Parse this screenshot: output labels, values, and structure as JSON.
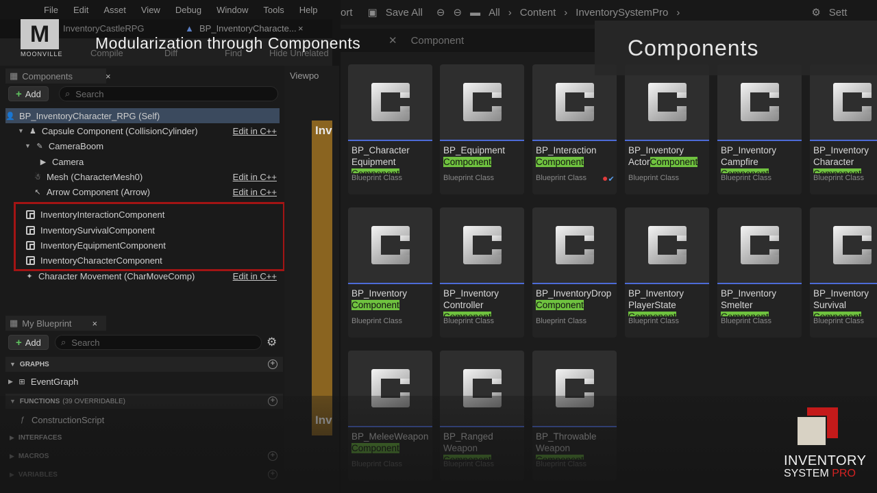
{
  "menu": [
    "File",
    "Edit",
    "Asset",
    "View",
    "Debug",
    "Window",
    "Tools",
    "Help"
  ],
  "doc_tabs": [
    "InventoryCastleRPG",
    "BP_InventoryCharacte..."
  ],
  "toolbar_ghost": [
    "Compile",
    "Diff",
    "Find",
    "Hide Unrelated"
  ],
  "components_panel": {
    "title": "Components",
    "add_label": "Add",
    "search_placeholder": "Search",
    "tree": [
      {
        "label": "BP_InventoryCharacter_RPG (Self)",
        "edit": ""
      },
      {
        "label": "Capsule Component (CollisionCylinder)",
        "edit": "Edit in C++"
      },
      {
        "label": "CameraBoom",
        "edit": ""
      },
      {
        "label": "Camera",
        "edit": ""
      },
      {
        "label": "Mesh (CharacterMesh0)",
        "edit": "Edit in C++"
      },
      {
        "label": "Arrow Component (Arrow)",
        "edit": "Edit in C++"
      },
      {
        "label": "InventoryInteractionComponent",
        "edit": ""
      },
      {
        "label": "InventorySurvivalComponent",
        "edit": ""
      },
      {
        "label": "InventoryEquipmentComponent",
        "edit": ""
      },
      {
        "label": "InventoryCharacterComponent",
        "edit": ""
      },
      {
        "label": "Character Movement (CharMoveComp)",
        "edit": "Edit in C++"
      }
    ]
  },
  "my_blueprint": {
    "title": "My Blueprint",
    "add_label": "Add",
    "search_placeholder": "Search",
    "graphs_label": "GRAPHS",
    "event_graph": "EventGraph",
    "functions_label": "FUNCTIONS",
    "functions_count": "(39 OVERRIDABLE)",
    "construction_script": "ConstructionScript",
    "interfaces_label": "INTERFACES",
    "macros_label": "MACROS",
    "variables_label": "VARIABLES"
  },
  "viewport": {
    "tab": "Viewpo",
    "node_label_1": "Inv",
    "node_label_2": "Inv"
  },
  "content_browser": {
    "save_all": "Save All",
    "path": [
      "All",
      "Content",
      "InventorySystemPro"
    ],
    "settings": "Sett",
    "filter_text": "Component",
    "assets": [
      {
        "pre": "BP_Character Equipment ",
        "hl": "Component",
        "post": "",
        "cls": "Blueprint Class",
        "badge": false
      },
      {
        "pre": "BP_Equipment ",
        "hl": "Component",
        "post": "",
        "cls": "Blueprint Class",
        "badge": false
      },
      {
        "pre": "BP_Interaction ",
        "hl": "Component",
        "post": "",
        "cls": "Blueprint Class",
        "badge": true
      },
      {
        "pre": "BP_Inventory Actor",
        "hl": "Component",
        "post": "",
        "cls": "Blueprint Class",
        "badge": false
      },
      {
        "pre": "BP_Inventory Campfire ",
        "hl": "Component",
        "post": "",
        "cls": "Blueprint Class",
        "badge": false
      },
      {
        "pre": "BP_Inventory Character ",
        "hl": "Component",
        "post": "",
        "cls": "Blueprint Class",
        "badge": false
      },
      {
        "pre": "BP_Inventory ",
        "hl": "Component",
        "post": "",
        "cls": "Blueprint Class",
        "badge": false
      },
      {
        "pre": "BP_Inventory Controller ",
        "hl": "Component",
        "post": "",
        "cls": "Blueprint Class",
        "badge": false
      },
      {
        "pre": "BP_InventoryDrop ",
        "hl": "Component",
        "post": "",
        "cls": "Blueprint Class",
        "badge": false
      },
      {
        "pre": "BP_Inventory PlayerState ",
        "hl": "Component",
        "post": "",
        "cls": "Blueprint Class",
        "badge": false
      },
      {
        "pre": "BP_Inventory Smelter ",
        "hl": "Component",
        "post": "",
        "cls": "Blueprint Class",
        "badge": false
      },
      {
        "pre": "BP_Inventory Survival ",
        "hl": "Component",
        "post": "",
        "cls": "Blueprint Class",
        "badge": false
      },
      {
        "pre": "BP_MeleeWeapon ",
        "hl": "Component",
        "post": "",
        "cls": "Blueprint Class",
        "badge": false
      },
      {
        "pre": "BP_Ranged Weapon ",
        "hl": "Component",
        "post": "",
        "cls": "Blueprint Class",
        "badge": false
      },
      {
        "pre": "BP_Throwable Weapon ",
        "hl": "Component",
        "post": "",
        "cls": "Blueprint Class",
        "badge": false
      }
    ]
  },
  "overlay": {
    "logo_letter": "M",
    "logo_text": "MOONVILLE",
    "title": "Modularization through Components",
    "banner": "Components",
    "brand_line1": "INVENTORY",
    "brand_line2a": "SYSTEM ",
    "brand_line2b": "PRO"
  }
}
